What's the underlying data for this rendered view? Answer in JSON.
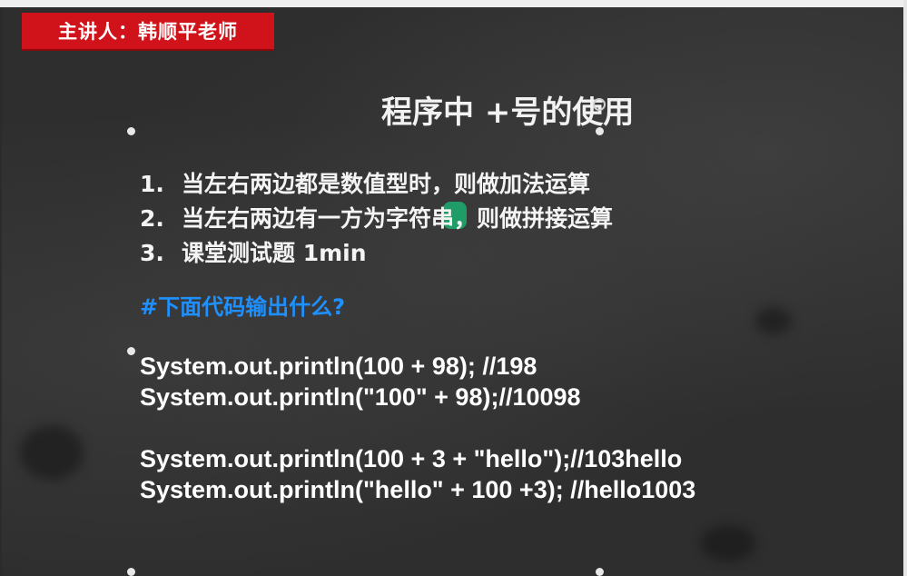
{
  "presenter": {
    "label": "主讲人：韩顺平老师"
  },
  "slide": {
    "title": "程序中 +号的使用",
    "rules": [
      {
        "num": "1.",
        "text": "当左右两边都是数值型时，则做加法运算"
      },
      {
        "num": "2.",
        "text": "当左右两边有一方为字符串，则做拼接运算"
      },
      {
        "num": "3.",
        "text": "课堂测试题 1min"
      }
    ],
    "question": "#下面代码输出什么?",
    "code": [
      "System.out.println(100 + 98); //198",
      "System.out.println(\"100\" + 98);//10098",
      "System.out.println(100 + 3 + \"hello\");//103hello",
      "System.out.println(\"hello\" + 100 +3); //hello1003"
    ]
  },
  "colors": {
    "badge": "#d0131a",
    "question": "#1e90ff",
    "cursor_highlight": "#18be78",
    "background": "#2e2e2e"
  }
}
